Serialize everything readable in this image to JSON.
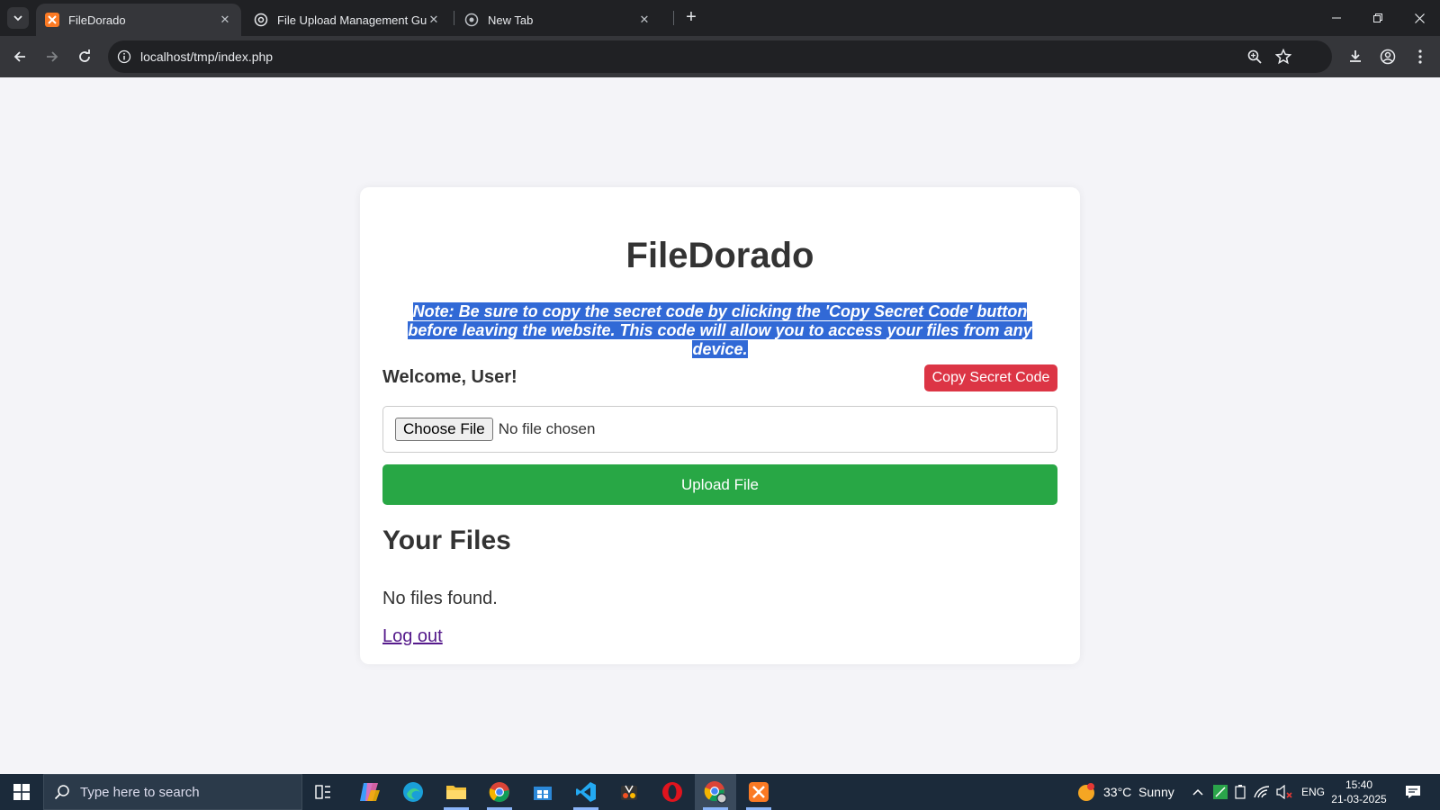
{
  "browser": {
    "tabs": [
      {
        "title": "FileDorado"
      },
      {
        "title": "File Upload Management Guide"
      },
      {
        "title": "New Tab"
      }
    ],
    "url": "localhost/tmp/index.php"
  },
  "page": {
    "title": "FileDorado",
    "note": "Note: Be sure to copy the secret code by clicking the 'Copy Secret Code' button before leaving the website. This code will allow you to access your files from any device.",
    "welcome": "Welcome, User!",
    "copy_button": "Copy Secret Code",
    "choose_file_button": "Choose File",
    "file_status": "No file chosen",
    "upload_button": "Upload File",
    "files_heading": "Your Files",
    "no_files": "No files found.",
    "logout": "Log out"
  },
  "taskbar": {
    "search_placeholder": "Type here to search",
    "weather": "33°C  Sunny",
    "language": "ENG",
    "time": "15:40",
    "date": "21-03-2025"
  },
  "colors": {
    "copy_button": "#dc3545",
    "upload_button": "#28a745",
    "selection_highlight": "#3169d6",
    "page_background": "#f4f4f8"
  }
}
